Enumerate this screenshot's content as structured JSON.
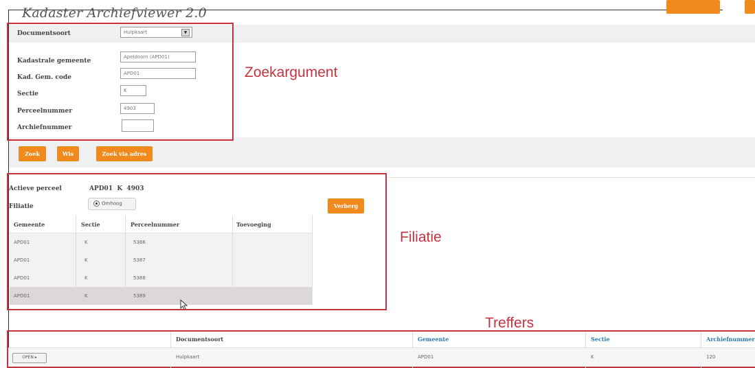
{
  "app": {
    "title": "Kadaster Archiefviewer 2.0"
  },
  "search": {
    "fields": [
      {
        "label": "Documentsoort",
        "value": "Hulpkaart"
      },
      {
        "label": "Kadastrale gemeente",
        "value": "Apeldoorn (APD01)"
      },
      {
        "label": "Kad. Gem. code",
        "value": "APD01"
      },
      {
        "label": "Sectie",
        "value": "K"
      },
      {
        "label": "Perceelnummer",
        "value": "4903"
      },
      {
        "label": "Archiefnummer",
        "value": ""
      }
    ],
    "buttons": {
      "search": "Zoek",
      "clear": "Wis",
      "address": "Zoek via adres"
    }
  },
  "annotations": {
    "zoek": "Zoekargument",
    "filiatie": "Filiatie",
    "treffers": "Treffers"
  },
  "filiatie": {
    "active_label": "Actieve perceel",
    "active_value": "APD01  K  4903",
    "filiatie_label": "Filiatie",
    "direction": "Omhoog",
    "hide_button": "Verberg",
    "columns": [
      "Gemeente",
      "Sectie",
      "Perceelnummer",
      "Toevoeging"
    ],
    "rows": [
      [
        "APD01",
        "K",
        "5386",
        ""
      ],
      [
        "APD01",
        "K",
        "5387",
        ""
      ],
      [
        "APD01",
        "K",
        "5388",
        ""
      ],
      [
        "APD01",
        "K",
        "5389",
        ""
      ]
    ]
  },
  "results": {
    "columns": [
      "Documentsoort",
      "Gemeente",
      "Sectie",
      "Archiefnummer"
    ],
    "rows": [
      {
        "open": "OPEN",
        "doc": "Hulpkaart",
        "gemeente": "APD01",
        "sectie": "K",
        "archief": "120"
      }
    ]
  },
  "colors": {
    "accent": "#f08a1c",
    "annotation": "#c8323e",
    "link": "#2a7ab0"
  }
}
